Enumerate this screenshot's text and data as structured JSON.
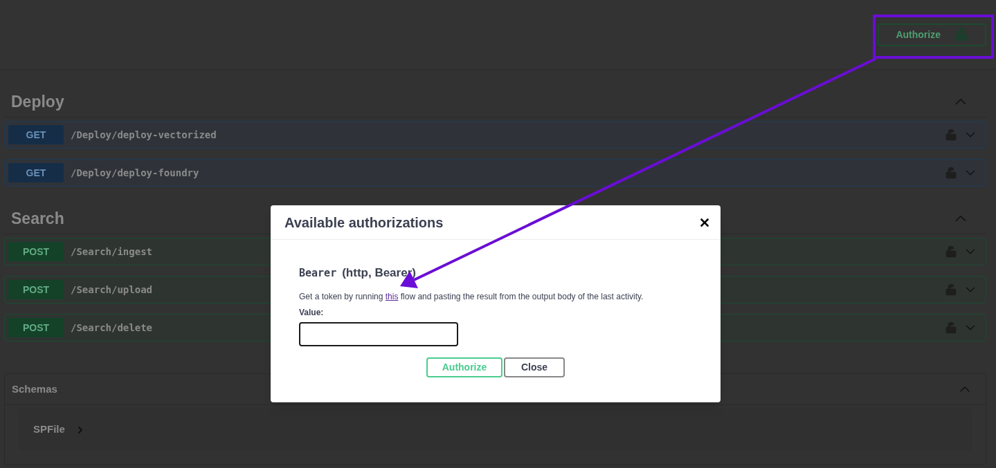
{
  "header": {
    "authorize_button": "Authorize"
  },
  "sections": [
    {
      "title": "Deploy",
      "expanded": true,
      "operations": [
        {
          "kind": "get",
          "method": "GET",
          "path": "/Deploy/deploy-vectorized",
          "expanded": false
        },
        {
          "kind": "get",
          "method": "GET",
          "path": "/Deploy/deploy-foundry",
          "expanded": false
        }
      ]
    },
    {
      "title": "Search",
      "expanded": true,
      "operations": [
        {
          "kind": "post",
          "method": "POST",
          "path": "/Search/ingest",
          "expanded": false
        },
        {
          "kind": "post",
          "method": "POST",
          "path": "/Search/upload",
          "expanded": false
        },
        {
          "kind": "post",
          "method": "POST",
          "path": "/Search/delete",
          "expanded": false
        }
      ]
    }
  ],
  "schemas": {
    "title": "Schemas",
    "expanded": true,
    "items": [
      {
        "name": "SPFile",
        "expanded": false
      }
    ]
  },
  "dialog": {
    "title": "Available authorizations",
    "scheme_name": "Bearer",
    "scheme_type": "(http, Bearer)",
    "description_before": "Get a token by running ",
    "description_link": "this",
    "description_after": " flow and pasting the result from the output body of the last activity.",
    "value_label": "Value:",
    "authorize_button": "Authorize",
    "close_button": "Close"
  }
}
